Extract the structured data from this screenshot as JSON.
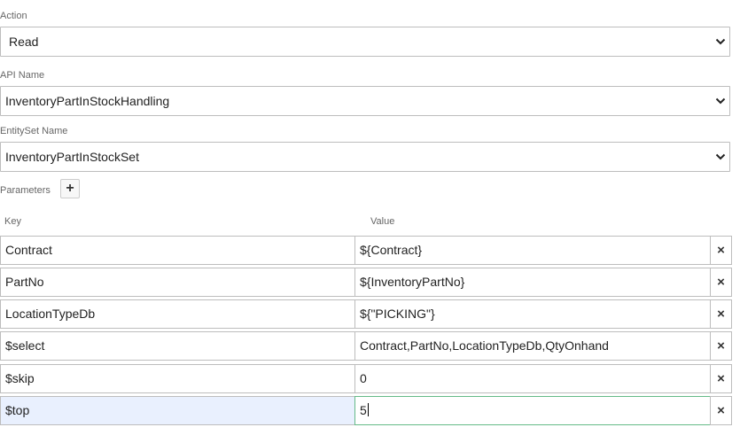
{
  "action": {
    "label": "Action",
    "value": "Read"
  },
  "api_name": {
    "label": "API Name",
    "value": "InventoryPartInStockHandling"
  },
  "entity_set": {
    "label": "EntitySet Name",
    "value": "InventoryPartInStockSet"
  },
  "parameters": {
    "label": "Parameters",
    "add_icon": "plus-icon",
    "add_glyph": "+",
    "remove_icon": "close-icon",
    "remove_glyph": "×",
    "columns": {
      "key": "Key",
      "value": "Value"
    },
    "rows": [
      {
        "key": "Contract",
        "value": "${Contract}"
      },
      {
        "key": "PartNo",
        "value": "${InventoryPartNo}"
      },
      {
        "key": "LocationTypeDb",
        "value": "${\"PICKING\"}"
      },
      {
        "key": "$select",
        "value": "Contract,PartNo,LocationTypeDb,QtyOnhand"
      },
      {
        "key": "$skip",
        "value": "0"
      },
      {
        "key": "$top",
        "value": "5"
      }
    ]
  },
  "colors": {
    "active_key_bg": "#e9f0fe",
    "focused_border": "#66bb88"
  }
}
